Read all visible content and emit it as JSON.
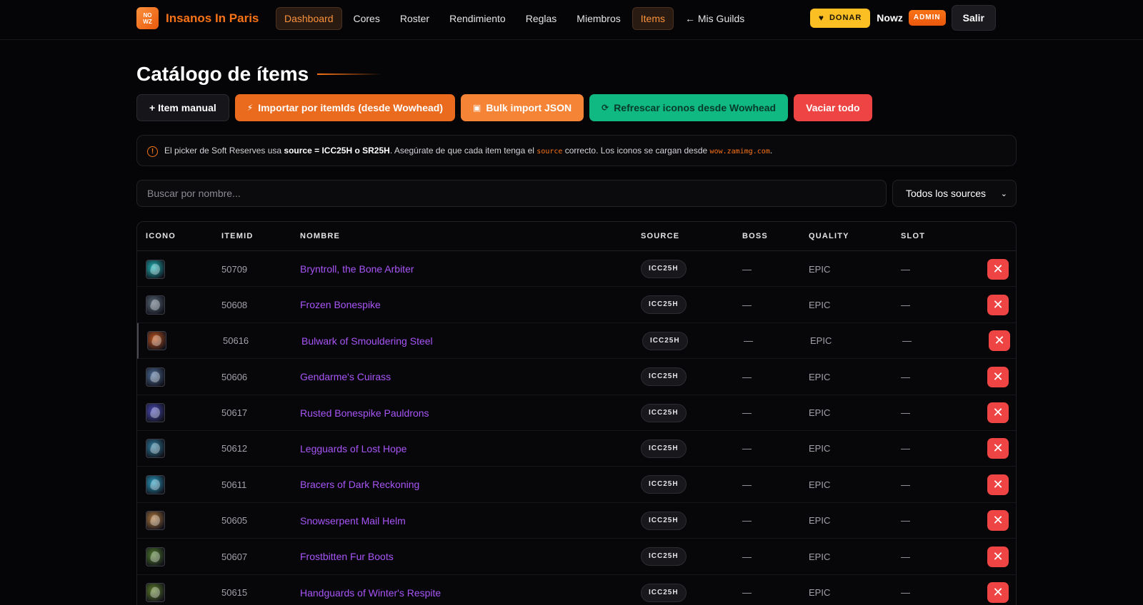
{
  "nav": {
    "brand_logo": "NOWZ",
    "brand_name": "Insanos In Paris",
    "items": [
      {
        "label": "Dashboard",
        "active": true
      },
      {
        "label": "Cores",
        "active": false
      },
      {
        "label": "Roster",
        "active": false
      },
      {
        "label": "Rendimiento",
        "active": false
      },
      {
        "label": "Reglas",
        "active": false
      },
      {
        "label": "Miembros",
        "active": false
      },
      {
        "label": "Items",
        "active": true
      }
    ],
    "guilds_link": "← Mis Guilds",
    "donate_label": "DONAR",
    "user_name": "Nowz",
    "role_badge": "ADMIN",
    "logout_label": "Salir"
  },
  "page": {
    "title": "Catálogo de ítems"
  },
  "actions": {
    "manual": "+ Item manual",
    "import": "Importar por itemIds (desde Wowhead)",
    "bulk": "Bulk import JSON",
    "refresh": "Refrescar iconos desde Wowhead",
    "clear": "Vaciar todo"
  },
  "notice": {
    "t1": "El picker de Soft Reserves usa ",
    "b1": "source = ICC25H o SR25H",
    "t2": ". Asegúrate de que cada item tenga el ",
    "c1": "source",
    "t3": " correcto. Los iconos se cargan desde ",
    "c2": "wow.zamimg.com",
    "t4": "."
  },
  "filters": {
    "search_placeholder": "Buscar por nombre...",
    "search_value": "",
    "source_selected": "Todos los sources"
  },
  "table": {
    "headers": {
      "icon": "ICONO",
      "itemid": "ITEMID",
      "name": "NOMBRE",
      "source": "SOURCE",
      "boss": "BOSS",
      "quality": "QUALITY",
      "slot": "SLOT"
    },
    "rows": [
      {
        "itemid": "50709",
        "name": "Bryntroll, the Bone Arbiter",
        "source": "ICC25H",
        "boss": "—",
        "quality": "EPIC",
        "slot": "—",
        "icon_color": "#1fb5b8"
      },
      {
        "itemid": "50608",
        "name": "Frozen Bonespike",
        "source": "ICC25H",
        "boss": "—",
        "quality": "EPIC",
        "slot": "—",
        "icon_color": "#5b6b7c"
      },
      {
        "itemid": "50616",
        "name": "Bulwark of Smouldering Steel",
        "source": "ICC25H",
        "boss": "—",
        "quality": "EPIC",
        "slot": "—",
        "icon_color": "#c2561f"
      },
      {
        "itemid": "50606",
        "name": "Gendarme's Cuirass",
        "source": "ICC25H",
        "boss": "—",
        "quality": "EPIC",
        "slot": "—",
        "icon_color": "#4e6f9a"
      },
      {
        "itemid": "50617",
        "name": "Rusted Bonespike Pauldrons",
        "source": "ICC25H",
        "boss": "—",
        "quality": "EPIC",
        "slot": "—",
        "icon_color": "#4a4bb8"
      },
      {
        "itemid": "50612",
        "name": "Legguards of Lost Hope",
        "source": "ICC25H",
        "boss": "—",
        "quality": "EPIC",
        "slot": "—",
        "icon_color": "#2e7ea0"
      },
      {
        "itemid": "50611",
        "name": "Bracers of Dark Reckoning",
        "source": "ICC25H",
        "boss": "—",
        "quality": "EPIC",
        "slot": "—",
        "icon_color": "#2a9fc4"
      },
      {
        "itemid": "50605",
        "name": "Snowserpent Mail Helm",
        "source": "ICC25H",
        "boss": "—",
        "quality": "EPIC",
        "slot": "—",
        "icon_color": "#b0793f"
      },
      {
        "itemid": "50607",
        "name": "Frostbitten Fur Boots",
        "source": "ICC25H",
        "boss": "—",
        "quality": "EPIC",
        "slot": "—",
        "icon_color": "#4f7a2c"
      },
      {
        "itemid": "50615",
        "name": "Handguards of Winter's Respite",
        "source": "ICC25H",
        "boss": "—",
        "quality": "EPIC",
        "slot": "—",
        "icon_color": "#5d7f2a"
      }
    ]
  }
}
